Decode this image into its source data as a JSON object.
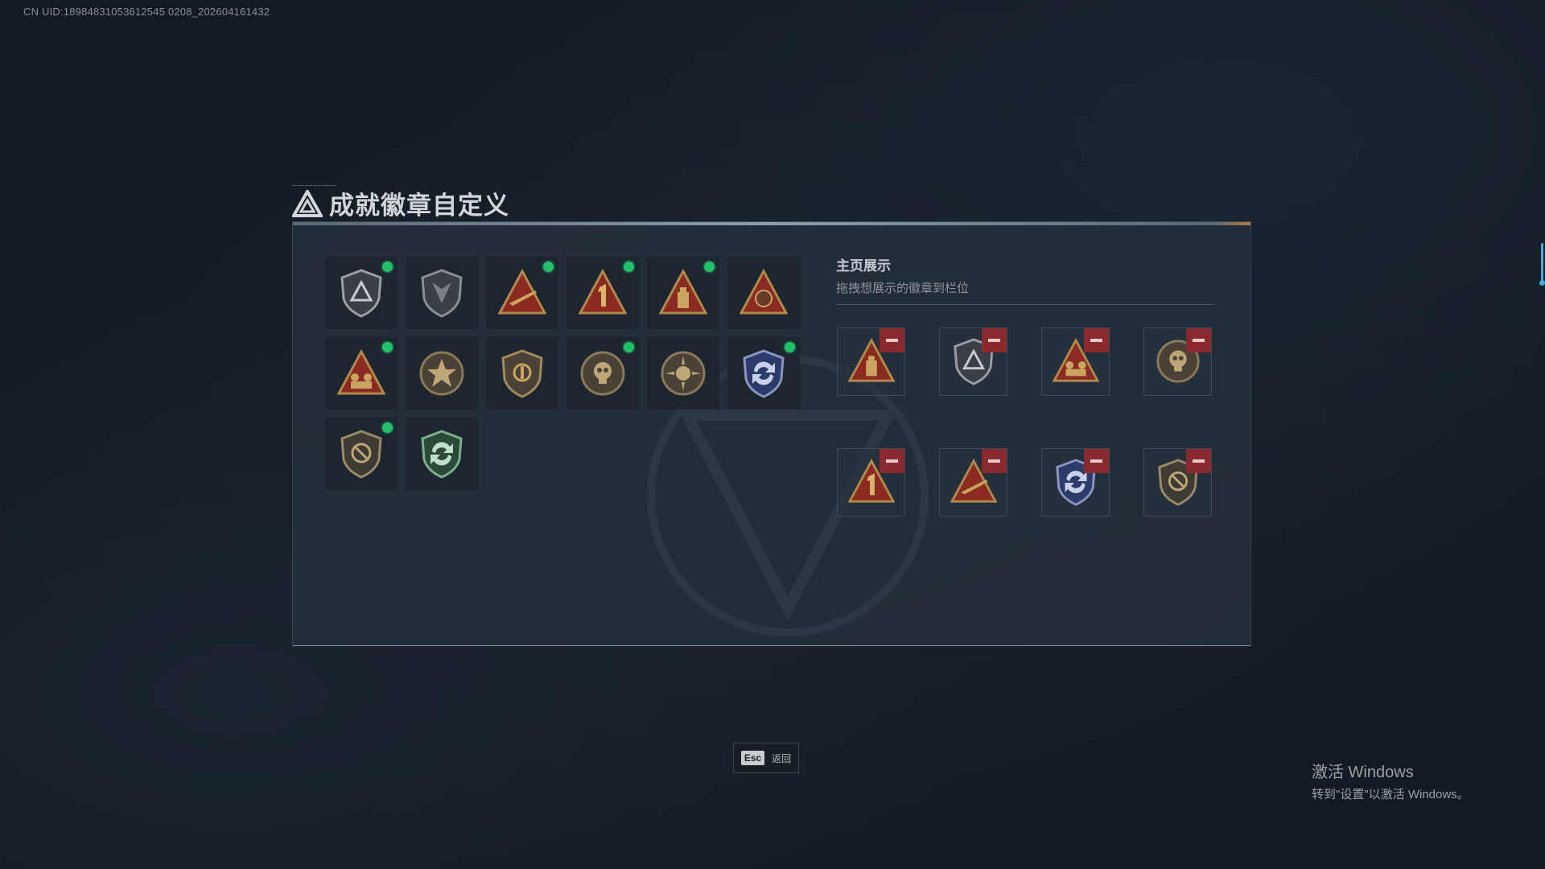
{
  "uid_label": "CN UID:18984831053612545 0208_202604161432",
  "title": "成就徽章自定义",
  "owned_badges": [
    {
      "icon": "triangle-shield-badge-icon",
      "new": true
    },
    {
      "icon": "wing-shield-badge-icon",
      "new": false
    },
    {
      "icon": "rifle-triangle-badge-icon",
      "new": true
    },
    {
      "icon": "number-one-triangle-badge-icon",
      "new": true
    },
    {
      "icon": "ammo-triangle-badge-icon",
      "new": true
    },
    {
      "icon": "lion-triangle-badge-icon",
      "new": false
    },
    {
      "icon": "squad-triangle-badge-icon",
      "new": true
    },
    {
      "icon": "star-round-badge-icon",
      "new": false
    },
    {
      "icon": "grip-shield-badge-icon",
      "new": false
    },
    {
      "icon": "skull-round-badge-icon",
      "new": true
    },
    {
      "icon": "sunburst-round-badge-icon",
      "new": false
    },
    {
      "icon": "blue-arrows-shield-badge-icon",
      "new": true
    },
    {
      "icon": "no-sign-shield-badge-icon",
      "new": true
    },
    {
      "icon": "green-arrows-shield-badge-icon",
      "new": false
    }
  ],
  "display": {
    "title": "主页展示",
    "subtitle": "拖拽想展示的徽章到栏位",
    "slots": [
      {
        "icon": "ammo-triangle-badge-icon"
      },
      {
        "icon": "triangle-shield-badge-icon"
      },
      {
        "icon": "squad-triangle-badge-icon"
      },
      {
        "icon": "skull-round-badge-icon"
      },
      {
        "icon": "number-one-triangle-badge-icon"
      },
      {
        "icon": "rifle-triangle-badge-icon"
      },
      {
        "icon": "blue-arrows-shield-badge-icon"
      },
      {
        "icon": "no-sign-shield-badge-icon"
      }
    ]
  },
  "esc": {
    "key": "Esc",
    "label": "返回"
  },
  "windows_activation": {
    "line1": "激活 Windows",
    "line2": "转到\"设置\"以激活 Windows。"
  },
  "colors": {
    "new_dot": "#22c06a",
    "remove_button": "#8a2a2f",
    "badge_gold": "#b08a4a",
    "badge_red": "#8a2a20"
  }
}
